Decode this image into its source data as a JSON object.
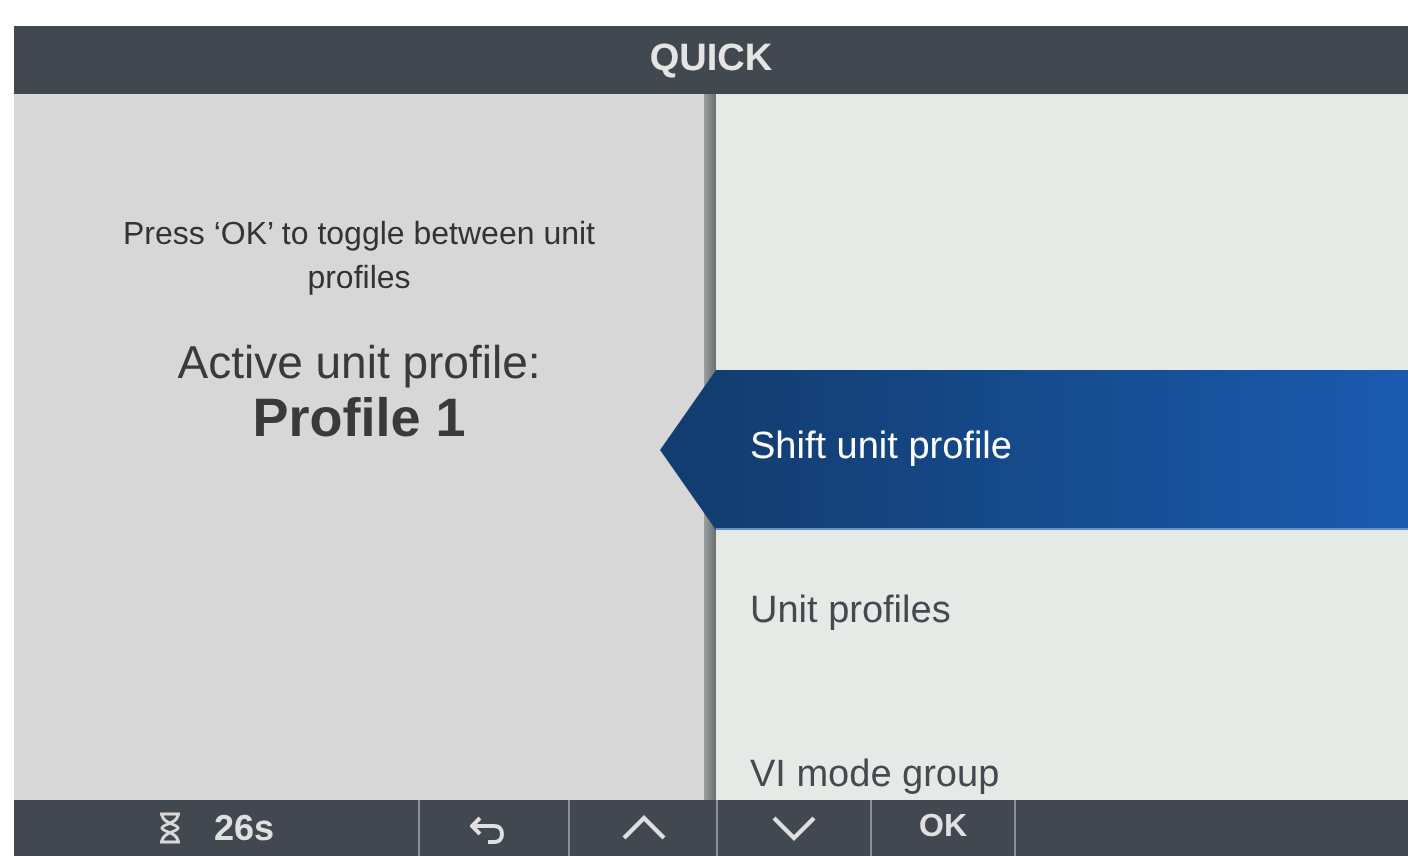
{
  "title": "QUICK",
  "info_panel": {
    "instruction": "Press ‘OK’ to toggle between unit profiles",
    "active_label": "Active unit profile:",
    "active_value": "Profile 1"
  },
  "menu": [
    {
      "label": "Shift unit profile",
      "selected": true
    },
    {
      "label": "Unit profiles",
      "selected": false
    },
    {
      "label": "VI mode group",
      "selected": false
    }
  ],
  "bottom_bar": {
    "timer": "26s",
    "keys": [
      {
        "kind": "back"
      },
      {
        "kind": "up"
      },
      {
        "kind": "down"
      },
      {
        "kind": "text",
        "label": "OK"
      }
    ]
  }
}
